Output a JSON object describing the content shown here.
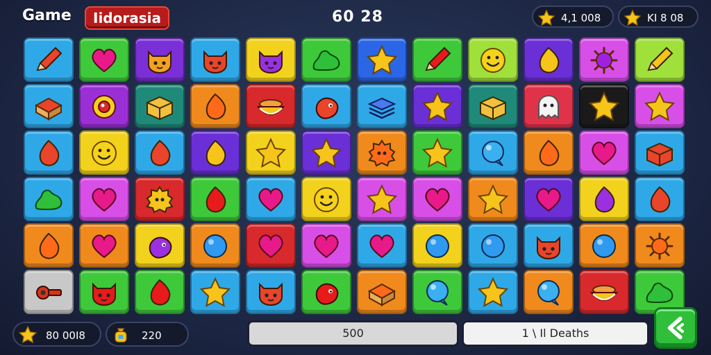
{
  "header": {
    "game_label": "Game",
    "title": "Iidorasia",
    "center_score": "60 28",
    "stat_1": "4,1 008",
    "stat_2": "KI 8 08"
  },
  "footer": {
    "coins": "80 00I8",
    "item_count": "220",
    "progress_value": "500",
    "progress_fill": 1.0,
    "deaths_label": "1 \\ Il Deaths"
  },
  "board": {
    "rows": 6,
    "cols": 12,
    "tiles": [
      [
        "#2fa8e8",
        "pencil"
      ],
      [
        "#3ec93a",
        "heart"
      ],
      [
        "#7b2fd6",
        "pet"
      ],
      [
        "#2fa8e8",
        "pet"
      ],
      [
        "#f2d21c",
        "pet"
      ],
      [
        "#3ec93a",
        "blob"
      ],
      [
        "#2a66e6",
        "star"
      ],
      [
        "#3ec93a",
        "pencil"
      ],
      [
        "#9fe03a",
        "smile"
      ],
      [
        "#6a2fd6",
        "drop"
      ],
      [
        "#d84fe8",
        "sun"
      ],
      [
        "#9fe03a",
        "pencil"
      ],
      [
        "#2fa8e8",
        "cake"
      ],
      [
        "#9b2fd6",
        "flower"
      ],
      [
        "#1f8a7a",
        "box"
      ],
      [
        "#f08a1c",
        "drop"
      ],
      [
        "#d8292c",
        "bowl"
      ],
      [
        "#2fa8e8",
        "bird"
      ],
      [
        "#2fa8e8",
        "stack"
      ],
      [
        "#6a2fd6",
        "star"
      ],
      [
        "#1f8a7a",
        "box"
      ],
      [
        "#e0334a",
        "ghost"
      ],
      [
        "#1a1a1a",
        "star"
      ],
      [
        "#d84fe8",
        "star"
      ],
      [
        "#2fa8e8",
        "drop"
      ],
      [
        "#f2d21c",
        "smile"
      ],
      [
        "#2fa8e8",
        "drop"
      ],
      [
        "#6a2fd6",
        "drop"
      ],
      [
        "#f2d21c",
        "star"
      ],
      [
        "#6a2fd6",
        "star"
      ],
      [
        "#f08a1c",
        "gear"
      ],
      [
        "#3ec93a",
        "star"
      ],
      [
        "#2fa8e8",
        "bubble"
      ],
      [
        "#f08a1c",
        "drop"
      ],
      [
        "#d84fe8",
        "heart"
      ],
      [
        "#2fa8e8",
        "box"
      ],
      [
        "#2fa8e8",
        "blob"
      ],
      [
        "#d84fe8",
        "heart"
      ],
      [
        "#d8292c",
        "gear"
      ],
      [
        "#3ec93a",
        "drop"
      ],
      [
        "#2fa8e8",
        "heart"
      ],
      [
        "#f2d21c",
        "smile"
      ],
      [
        "#d84fe8",
        "star"
      ],
      [
        "#d84fe8",
        "heart"
      ],
      [
        "#f08a1c",
        "star"
      ],
      [
        "#6a2fd6",
        "heart"
      ],
      [
        "#f2d21c",
        "drop"
      ],
      [
        "#2fa8e8",
        "drop"
      ],
      [
        "#f08a1c",
        "drop"
      ],
      [
        "#f08a1c",
        "heart"
      ],
      [
        "#f2d21c",
        "bird"
      ],
      [
        "#f08a1c",
        "circle"
      ],
      [
        "#d8292c",
        "heart"
      ],
      [
        "#d84fe8",
        "heart"
      ],
      [
        "#2fa8e8",
        "heart"
      ],
      [
        "#f2d21c",
        "circle"
      ],
      [
        "#2fa8e8",
        "circle"
      ],
      [
        "#2fa8e8",
        "pet"
      ],
      [
        "#f08a1c",
        "circle"
      ],
      [
        "#f08a1c",
        "sun"
      ],
      [
        "#c8c8c8",
        "key"
      ],
      [
        "#3ec93a",
        "pet"
      ],
      [
        "#3ec93a",
        "drop"
      ],
      [
        "#2fa8e8",
        "star"
      ],
      [
        "#2fa8e8",
        "pet"
      ],
      [
        "#3ec93a",
        "bird"
      ],
      [
        "#f08a1c",
        "cake"
      ],
      [
        "#3ec93a",
        "bubble"
      ],
      [
        "#2fa8e8",
        "star"
      ],
      [
        "#f08a1c",
        "bubble"
      ],
      [
        "#d8292c",
        "bowl"
      ],
      [
        "#3ec93a",
        "blob"
      ]
    ]
  },
  "colors": {
    "title_badge": "#b81b1b",
    "progress_fill": "#d8d8d8",
    "deaths_bar": "#f2f2f2",
    "next_button": "#2fbf3a",
    "star": "#f6c41a"
  },
  "icons": {
    "stat": "star-icon",
    "item": "coin-bag-icon",
    "next": "arrow-icon"
  }
}
